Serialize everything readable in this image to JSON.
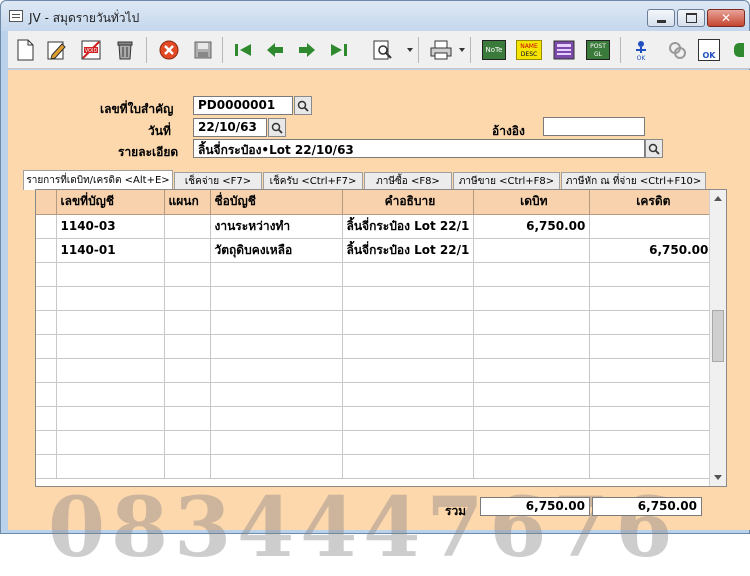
{
  "window": {
    "title": "JV - สมุดรายวันทั่วไป",
    "close_glyph": "✕"
  },
  "toolbar": {
    "icons": [
      "new-icon",
      "edit-icon",
      "void-icon",
      "delete-icon",
      "cancel-icon",
      "save-icon",
      "first-icon",
      "prev-icon",
      "next-icon",
      "last-icon",
      "find-icon",
      "print-icon",
      "note-icon",
      "name-desc-icon",
      "calc-icon",
      "post-gl-icon",
      "approve-icon",
      "unapprove-icon",
      "ok-icon"
    ],
    "note_label": "NoTe",
    "name_desc_top": "NAME",
    "name_desc_bottom": "DESC",
    "post_top": "POST",
    "post_bottom": "GL",
    "ok_label": "OK"
  },
  "form": {
    "doc_no_label": "เลขที่ใบสำคัญ",
    "doc_no_value": "PD0000001",
    "date_label": "วันที่",
    "date_value": "22/10/63",
    "ref_label": "อ้างอิง",
    "ref_value": "",
    "desc_label": "รายละเอียด",
    "desc_value": "ลิ้นจี่กระป๋อง•Lot 22/10/63"
  },
  "tabs": [
    {
      "label": "รายการที่เดบิท/เครดิต <Alt+E>",
      "active": true
    },
    {
      "label": "เช็คจ่าย <F7>",
      "active": false
    },
    {
      "label": "เช็ครับ <Ctrl+F7>",
      "active": false
    },
    {
      "label": "ภาษีซื้อ <F8>",
      "active": false
    },
    {
      "label": "ภาษีขาย <Ctrl+F8>",
      "active": false
    },
    {
      "label": "ภาษีหัก ณ ที่จ่าย <Ctrl+F10>",
      "active": false
    }
  ],
  "grid": {
    "columns": [
      "เลขที่บัญชี",
      "แผนก",
      "ชื่อบัญชี",
      "คำอธิบาย",
      "เดบิท",
      "เครดิต"
    ],
    "rows": [
      {
        "account": "1140-03",
        "dept": "",
        "name": "งานระหว่างทำ",
        "desc": "ลิ้นจี่กระป๋อง Lot 22/1",
        "debit": "6,750.00",
        "credit": ""
      },
      {
        "account": "1140-01",
        "dept": "",
        "name": "วัตถุดิบคงเหลือ",
        "desc": "ลิ้นจี่กระป๋อง Lot 22/1",
        "debit": "",
        "credit": "6,750.00"
      }
    ]
  },
  "totals": {
    "label": "รวม",
    "debit": "6,750.00",
    "credit": "6,750.00"
  },
  "watermark": "0834447676"
}
